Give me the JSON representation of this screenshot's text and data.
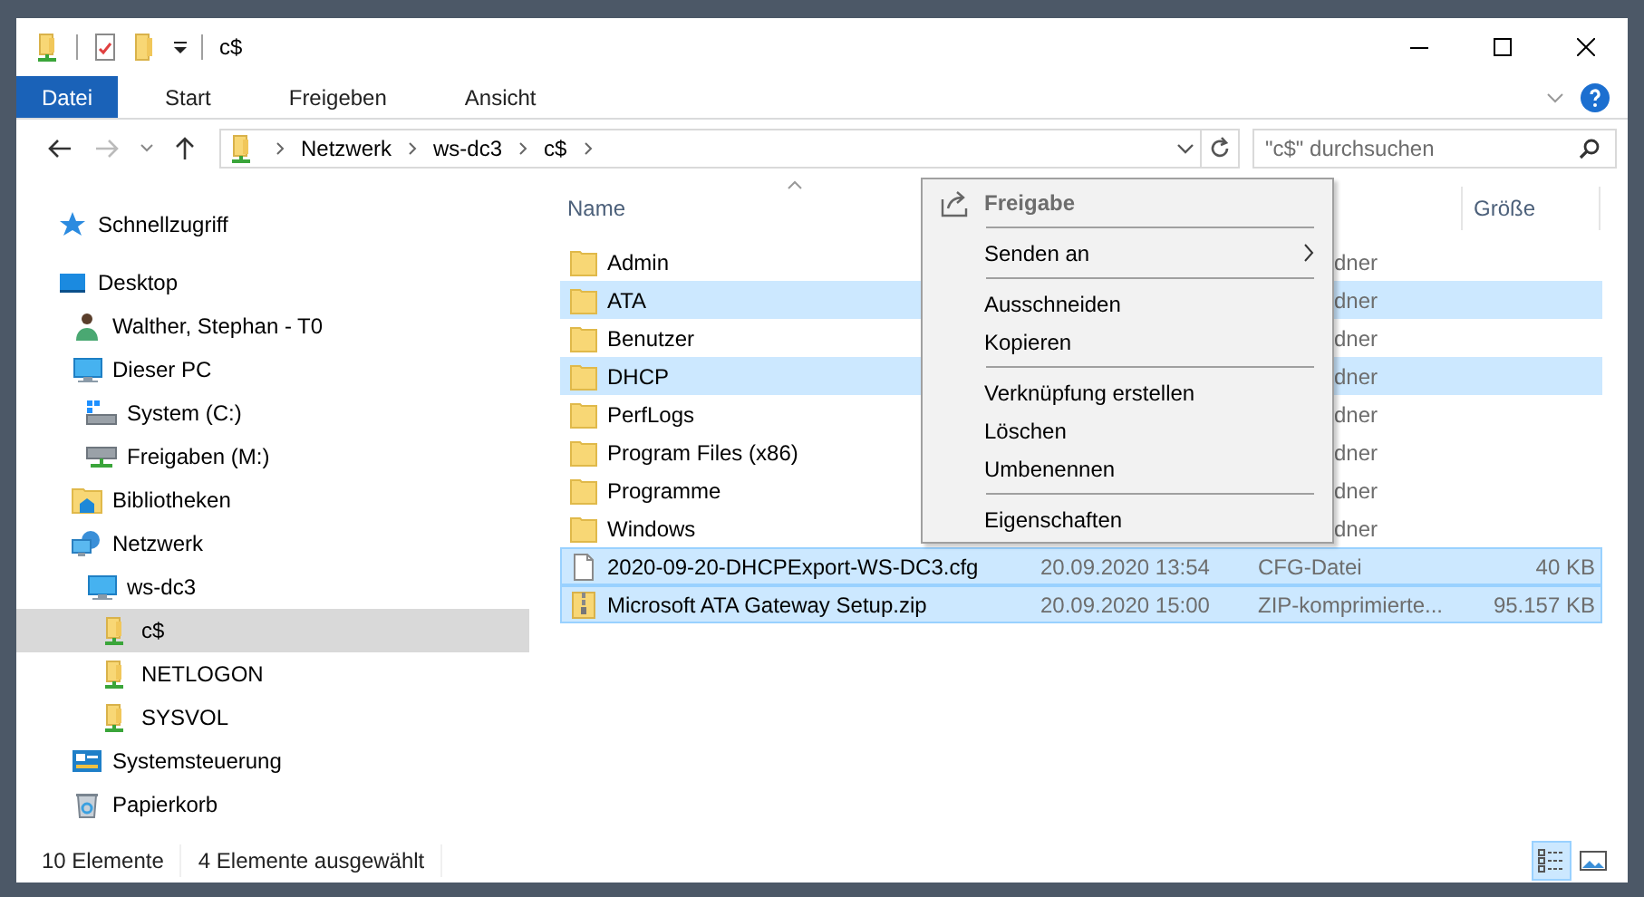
{
  "window": {
    "title": "c$"
  },
  "ribbon_tabs": [
    {
      "label": "Datei",
      "kind": "file"
    },
    {
      "label": "Start",
      "kind": "tab"
    },
    {
      "label": "Freigeben",
      "kind": "tab"
    },
    {
      "label": "Ansicht",
      "kind": "tab"
    }
  ],
  "address_bar": {
    "breadcrumbs": [
      "Netzwerk",
      "ws-dc3",
      "c$"
    ]
  },
  "search": {
    "placeholder": "\"c$\" durchsuchen"
  },
  "sidebar": {
    "items": [
      {
        "label": "Schnellzugriff",
        "kind": "quick-access",
        "selected": false
      },
      {
        "label": "Desktop",
        "kind": "desktop",
        "selected": false,
        "children": [
          {
            "label": "Walther, Stephan - T0",
            "kind": "user",
            "selected": false
          },
          {
            "label": "Dieser PC",
            "kind": "pc",
            "selected": false,
            "children": [
              {
                "label": "System (C:)",
                "kind": "drive",
                "selected": false
              },
              {
                "label": "Freigaben (M:)",
                "kind": "net-drive",
                "selected": false
              }
            ]
          },
          {
            "label": "Bibliotheken",
            "kind": "library",
            "selected": false
          },
          {
            "label": "Netzwerk",
            "kind": "network",
            "selected": false,
            "children": [
              {
                "label": "ws-dc3",
                "kind": "pc",
                "selected": false,
                "children": [
                  {
                    "label": "c$",
                    "kind": "share",
                    "selected": true
                  },
                  {
                    "label": "NETLOGON",
                    "kind": "share",
                    "selected": false
                  },
                  {
                    "label": "SYSVOL",
                    "kind": "share",
                    "selected": false
                  }
                ]
              }
            ]
          },
          {
            "label": "Systemsteuerung",
            "kind": "control-panel",
            "selected": false
          },
          {
            "label": "Papierkorb",
            "kind": "recycle-bin",
            "selected": false
          }
        ]
      }
    ]
  },
  "columns": [
    {
      "label": "Name",
      "kind": "name",
      "sorted": true
    },
    {
      "label": "Größe",
      "kind": "size",
      "sorted": false
    }
  ],
  "files": [
    {
      "name": "Admin",
      "kind": "folder",
      "type": "dner",
      "selected": false
    },
    {
      "name": "ATA",
      "kind": "folder",
      "type": "dner",
      "selected": true
    },
    {
      "name": "Benutzer",
      "kind": "folder",
      "type": "dner",
      "selected": false
    },
    {
      "name": "DHCP",
      "kind": "folder",
      "type": "dner",
      "selected": true
    },
    {
      "name": "PerfLogs",
      "kind": "folder",
      "type": "dner",
      "selected": false
    },
    {
      "name": "Program Files (x86)",
      "kind": "folder",
      "type": "dner",
      "selected": false
    },
    {
      "name": "Programme",
      "kind": "folder",
      "type": "dner",
      "selected": false
    },
    {
      "name": "Windows",
      "kind": "folder",
      "type": "dner",
      "selected": false
    },
    {
      "name": "2020-09-20-DHCPExport-WS-DC3.cfg",
      "kind": "file",
      "date": "20.09.2020 13:54",
      "type": "CFG-Datei",
      "size": "40 KB",
      "selected": true
    },
    {
      "name": "Microsoft ATA Gateway Setup.zip",
      "kind": "zip",
      "date": "20.09.2020 15:00",
      "type": "ZIP-komprimierte...",
      "size": "95.157 KB",
      "selected": true
    }
  ],
  "context_menu": {
    "groups": [
      [
        {
          "label": "Freigabe",
          "kind": "share",
          "disabled": true
        }
      ],
      [
        {
          "label": "Senden an",
          "kind": "submenu",
          "disabled": false
        }
      ],
      [
        {
          "label": "Ausschneiden",
          "kind": "command",
          "disabled": false
        },
        {
          "label": "Kopieren",
          "kind": "command",
          "disabled": false
        }
      ],
      [
        {
          "label": "Verknüpfung erstellen",
          "kind": "command",
          "disabled": false
        },
        {
          "label": "Löschen",
          "kind": "command",
          "disabled": false
        },
        {
          "label": "Umbenennen",
          "kind": "command",
          "disabled": false
        }
      ],
      [
        {
          "label": "Eigenschaften",
          "kind": "command",
          "disabled": false
        }
      ]
    ]
  },
  "status_bar": {
    "items": [
      "10 Elemente",
      "4 Elemente ausgewählt"
    ],
    "views": [
      {
        "kind": "details",
        "selected": true
      },
      {
        "kind": "tiles",
        "selected": false
      }
    ]
  }
}
